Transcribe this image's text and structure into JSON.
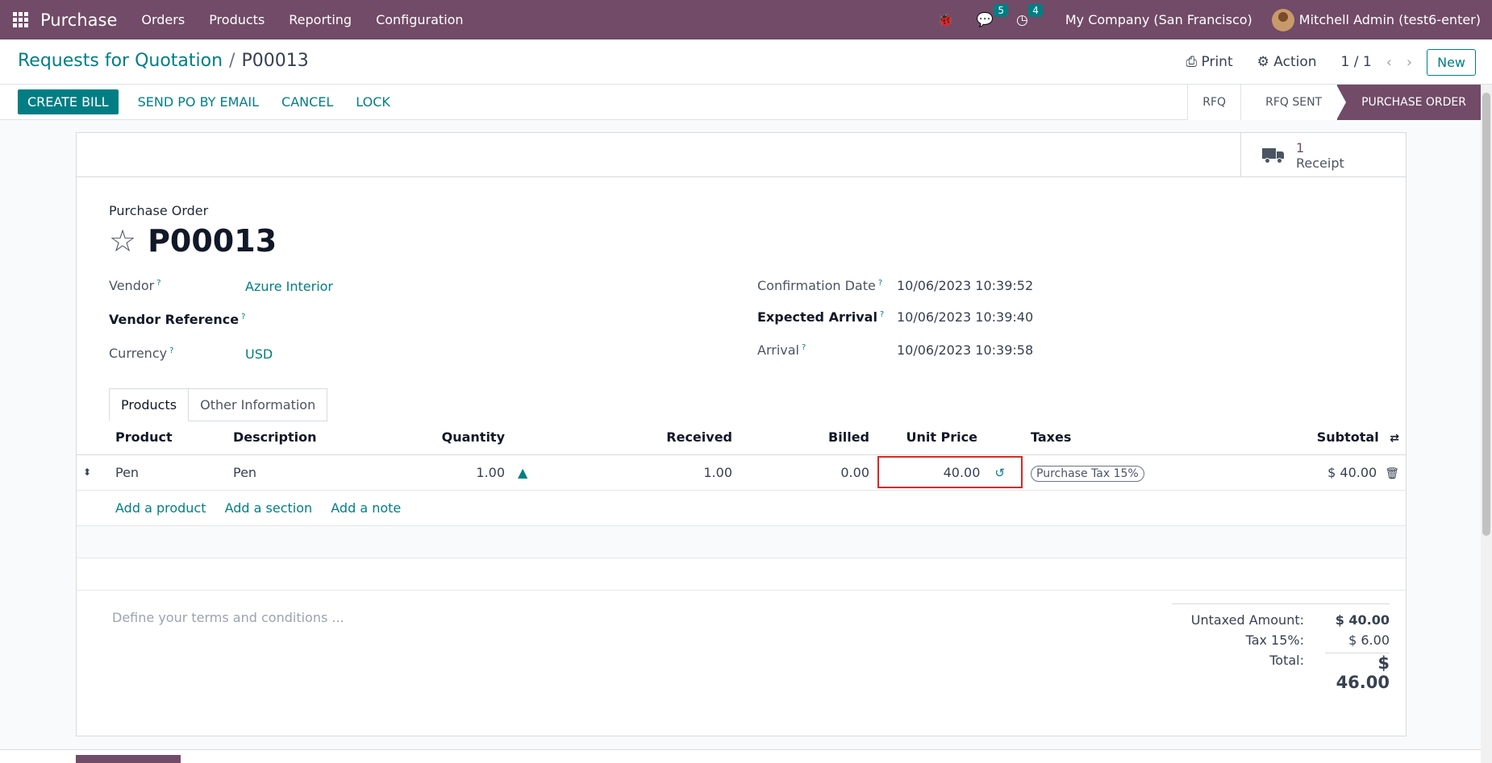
{
  "navbar": {
    "brand": "Purchase",
    "menu": [
      "Orders",
      "Products",
      "Reporting",
      "Configuration"
    ],
    "chat_badge": "5",
    "activity_badge": "4",
    "company": "My Company (San Francisco)",
    "user": "Mitchell Admin (test6-enter)"
  },
  "control": {
    "breadcrumb_parent": "Requests for Quotation",
    "breadcrumb_current": "P00013",
    "print": "Print",
    "action": "Action",
    "pager": "1 / 1",
    "new": "New"
  },
  "actions": {
    "create_bill": "CREATE BILL",
    "send_email": "SEND PO BY EMAIL",
    "cancel": "CANCEL",
    "lock": "LOCK"
  },
  "stages": [
    "RFQ",
    "RFQ SENT",
    "PURCHASE ORDER"
  ],
  "receipt": {
    "count": "1",
    "label": "Receipt"
  },
  "form": {
    "title_label": "Purchase Order",
    "title": "P00013",
    "vendor_label": "Vendor",
    "vendor": "Azure Interior",
    "vendor_ref_label": "Vendor Reference",
    "currency_label": "Currency",
    "currency": "USD",
    "confirmation_label": "Confirmation Date",
    "confirmation": "10/06/2023 10:39:52",
    "expected_label": "Expected Arrival",
    "expected": "10/06/2023 10:39:40",
    "arrival_label": "Arrival",
    "arrival": "10/06/2023 10:39:58",
    "help": "?"
  },
  "tabs": [
    "Products",
    "Other Information"
  ],
  "lines": {
    "headers": [
      "Product",
      "Description",
      "Quantity",
      "Received",
      "Billed",
      "Unit Price",
      "Taxes",
      "Subtotal"
    ],
    "rows": [
      {
        "product": "Pen",
        "description": "Pen",
        "quantity": "1.00",
        "received": "1.00",
        "billed": "0.00",
        "unit_price": "40.00",
        "tax": "Purchase Tax 15%",
        "subtotal": "$ 40.00"
      }
    ],
    "add_product": "Add a product",
    "add_section": "Add a section",
    "add_note": "Add a note"
  },
  "notes_placeholder": "Define your terms and conditions ...",
  "totals": {
    "untaxed_label": "Untaxed Amount:",
    "untaxed": "$ 40.00",
    "tax_label": "Tax 15%:",
    "tax": "$ 6.00",
    "total_label": "Total:",
    "total": "$ 46.00"
  }
}
